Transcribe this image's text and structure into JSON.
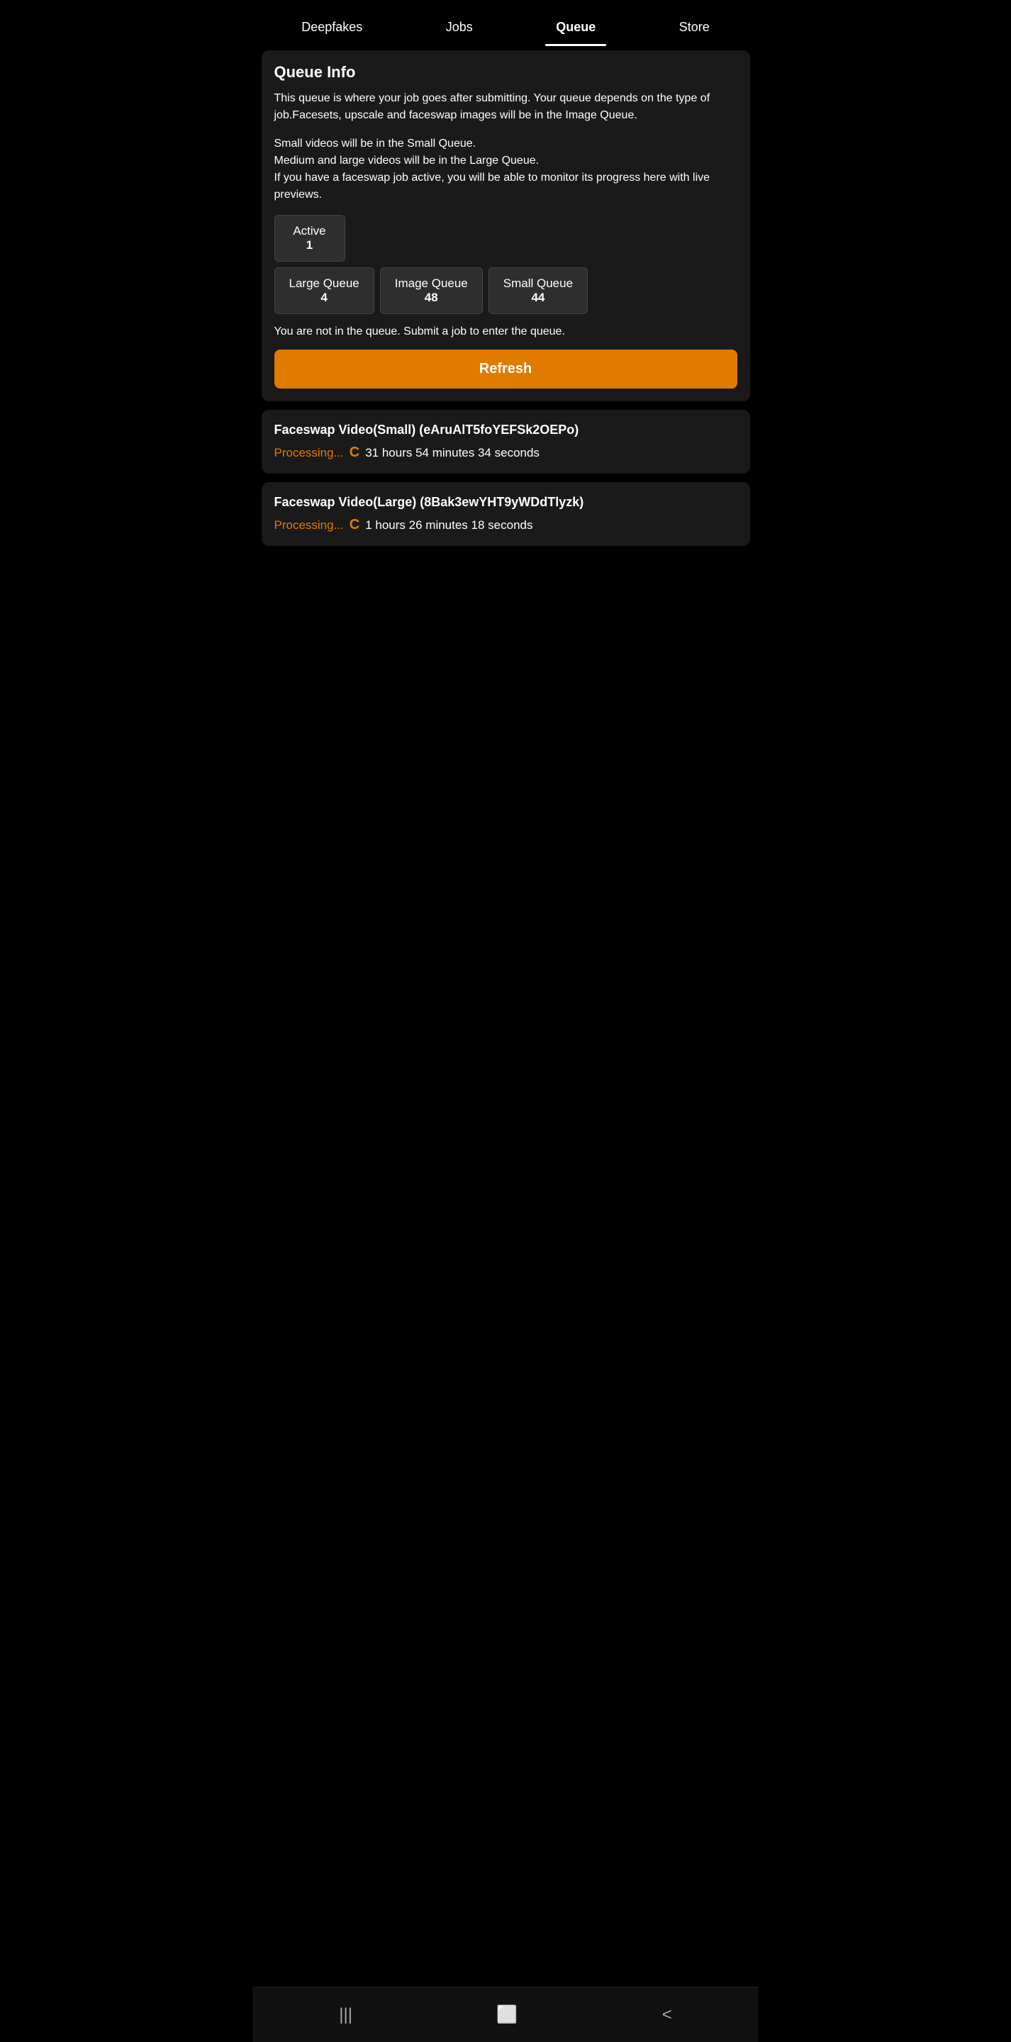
{
  "nav": {
    "items": [
      {
        "label": "Deepfakes",
        "active": false
      },
      {
        "label": "Jobs",
        "active": false
      },
      {
        "label": "Queue",
        "active": true
      },
      {
        "label": "Store",
        "active": false
      }
    ]
  },
  "queue_info": {
    "title": "Queue Info",
    "description_1": "This queue is where your job goes after submitting. Your queue depends on the type of job.Facesets, upscale and faceswap images will be in the Image Queue.",
    "description_2": "Small videos will be in the Small Queue.\nMedium and large videos will be in the Large Queue.\nIf you have a faceswap job active, you will be able to monitor its progress here with live previews.",
    "stats": {
      "active_label": "Active",
      "active_value": "1",
      "large_queue_label": "Large Queue",
      "large_queue_value": "4",
      "image_queue_label": "Image Queue",
      "image_queue_value": "48",
      "small_queue_label": "Small Queue",
      "small_queue_value": "44"
    },
    "status_text": "You are not in the queue. Submit a job to enter the queue.",
    "refresh_label": "Refresh"
  },
  "jobs": [
    {
      "title": "Faceswap Video(Small) (eAruAlT5foYEFSk2OEPo)",
      "status": "Processing...",
      "time": "31 hours 54 minutes 34 seconds"
    },
    {
      "title": "Faceswap Video(Large) (8Bak3ewYHT9yWDdTlyzk)",
      "status": "Processing...",
      "time": "1 hours 26 minutes 18 seconds"
    }
  ],
  "bottom_nav": {
    "recent_apps_icon": "|||",
    "home_icon": "⬜",
    "back_icon": "<"
  }
}
